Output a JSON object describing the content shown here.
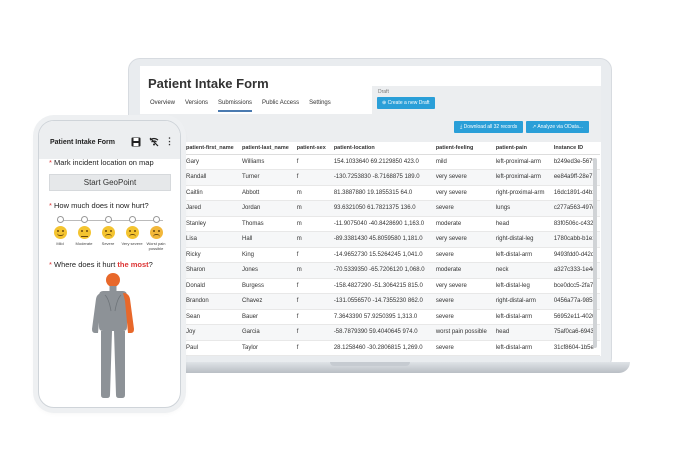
{
  "laptop": {
    "form_title": "Patient Intake Form",
    "tabs": [
      "Overview",
      "Versions",
      "Submissions",
      "Public Access",
      "Settings"
    ],
    "active_tab": "Submissions",
    "draft_label": "Draft",
    "create_draft_label": "Create a new Draft",
    "download_label": "Download all 32 records",
    "odata_label": "Analyze via OData...",
    "table": {
      "headers": [
        "",
        "patient-first_name",
        "patient-last_name",
        "patient-sex",
        "patient-location",
        "patient-feeling",
        "patient-pain",
        "Instance ID"
      ],
      "rows": [
        [
          "9",
          "Gary",
          "Williams",
          "f",
          "154.1033640 69.2129850 423.0",
          "mild",
          "left-proximal-arm",
          "b249ed3e-5679"
        ],
        [
          "9",
          "Randall",
          "Turner",
          "f",
          "-130.7253830 -8.7168875 189.0",
          "very severe",
          "left-proximal-arm",
          "ee84a9ff-28e7"
        ],
        [
          "9",
          "Caitlin",
          "Abbott",
          "m",
          "81.3887880 19.1855315 64.0",
          "very severe",
          "right-proximal-arm",
          "16dc1891-d4b1"
        ],
        [
          "9",
          "Jared",
          "Jordan",
          "m",
          "93.6321050 61.7821375 136.0",
          "severe",
          "lungs",
          "c277a563-497d"
        ],
        [
          "9",
          "Stanley",
          "Thomas",
          "m",
          "-11.9075040 -40.8428690 1,163.0",
          "moderate",
          "head",
          "83f0506c-c432"
        ],
        [
          "9",
          "Lisa",
          "Hall",
          "m",
          "-89.3381430 45.8059580 1,181.0",
          "very severe",
          "right-distal-leg",
          "1780cabb-b1e1"
        ],
        [
          "9",
          "Ricky",
          "King",
          "f",
          "-14.9652730 15.5264245 1,041.0",
          "severe",
          "left-distal-arm",
          "9493fdd0-d42d"
        ],
        [
          "9",
          "Sharon",
          "Jones",
          "m",
          "-70.5339350 -65.7206120 1,068.0",
          "moderate",
          "neck",
          "a327c333-1e4e"
        ],
        [
          "9",
          "Donald",
          "Burgess",
          "f",
          "-158.4827290 -51.3064215 815.0",
          "very severe",
          "left-distal-leg",
          "bce0dcc5-2fa7"
        ],
        [
          "9",
          "Brandon",
          "Chavez",
          "f",
          "-131.0556570 -14.7355230 862.0",
          "severe",
          "right-distal-arm",
          "0456a77a-9858"
        ],
        [
          "9",
          "Sean",
          "Bauer",
          "f",
          "7.3643390 57.9250395 1,313.0",
          "severe",
          "left-distal-arm",
          "56952e11-4020"
        ],
        [
          "9",
          "Joy",
          "Garcia",
          "f",
          "-58.7879390 59.4040645 974.0",
          "worst pain possible",
          "head",
          "75af0ca6-6943"
        ],
        [
          "9",
          "Paul",
          "Taylor",
          "f",
          "28.1258460 -30.2806815 1,269.0",
          "severe",
          "left-distal-arm",
          "31cf8604-1b5e"
        ]
      ]
    }
  },
  "phone": {
    "title": "Patient Intake Form",
    "q1": "Mark incident location on map",
    "geo_button": "Start GeoPoint",
    "q2": "How much does it now hurt?",
    "scale": [
      "Mild",
      "Moderate",
      "Severe",
      "Very severe",
      "Worst pain possible"
    ],
    "q3_prefix": "Where does it hurt ",
    "q3_highlight": "the most",
    "q3_suffix": "?",
    "required_mark": "*"
  },
  "colors": {
    "accent": "#2a9fd8",
    "highlight": "#e8682a",
    "required": "#dd3333"
  },
  "icons": [
    "save-icon",
    "offline-icon",
    "more-icon",
    "plus-icon",
    "download-icon"
  ]
}
